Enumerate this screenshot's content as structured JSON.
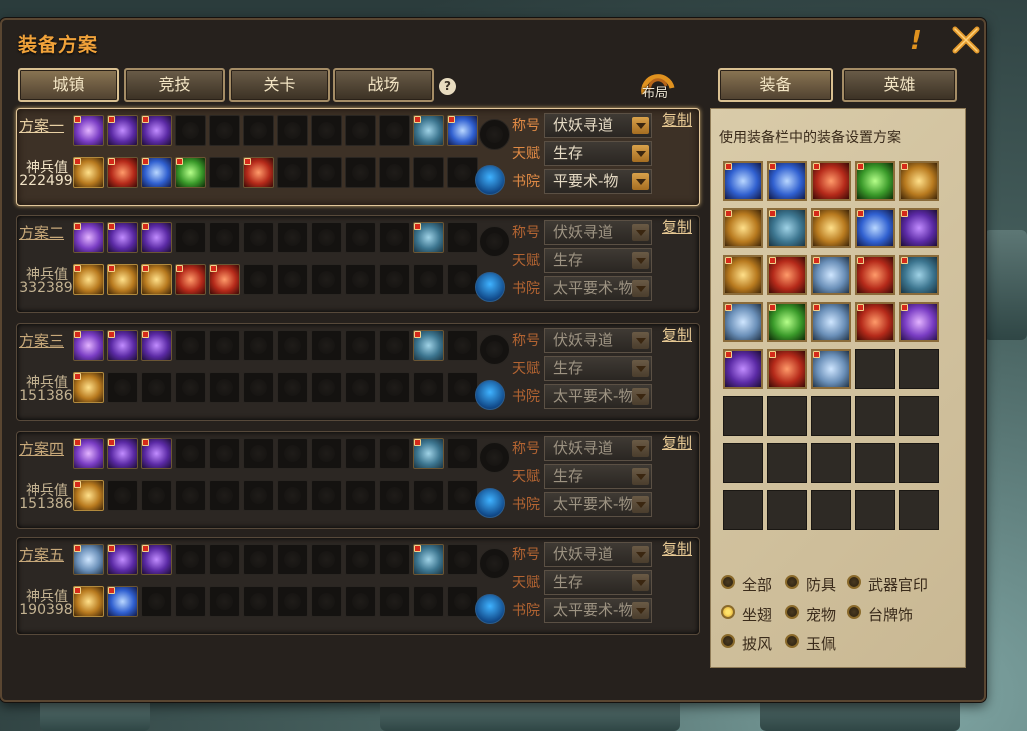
{
  "window": {
    "title": "装备方案"
  },
  "left_tabs": [
    {
      "label": "城镇",
      "active": true
    },
    {
      "label": "竞技",
      "active": false
    },
    {
      "label": "关卡",
      "active": false
    },
    {
      "label": "战场",
      "active": false
    }
  ],
  "layout_button": {
    "label": "布局"
  },
  "right_tabs": [
    {
      "label": "装备",
      "active": true
    },
    {
      "label": "英雄",
      "active": false
    }
  ],
  "field_labels": {
    "title": "称号",
    "talent": "天赋",
    "academy": "书院"
  },
  "power_label": "神兵值",
  "copy_label": "复制",
  "plans": [
    {
      "name": "方案一",
      "power": "222499",
      "title": "伏妖寻道",
      "talent": "生存",
      "academy": "平要术-物",
      "active": true
    },
    {
      "name": "方案二",
      "power": "332389",
      "title": "伏妖寻道",
      "talent": "生存",
      "academy": "太平要术-物",
      "active": false
    },
    {
      "name": "方案三",
      "power": "151386",
      "title": "伏妖寻道",
      "talent": "生存",
      "academy": "太平要术-物",
      "active": false
    },
    {
      "name": "方案四",
      "power": "151386",
      "title": "伏妖寻道",
      "talent": "生存",
      "academy": "太平要术-物",
      "active": false
    },
    {
      "name": "方案五",
      "power": "190398",
      "title": "伏妖寻道",
      "talent": "生存",
      "academy": "太平要术-物",
      "active": false
    }
  ],
  "panel": {
    "description": "使用装备栏中的装备设置方案",
    "filters": [
      {
        "label": "全部",
        "checked": false
      },
      {
        "label": "防具",
        "checked": false
      },
      {
        "label": "武器官印",
        "checked": false
      },
      {
        "label": "坐翅",
        "checked": true
      },
      {
        "label": "宠物",
        "checked": false
      },
      {
        "label": "台牌饰",
        "checked": false
      },
      {
        "label": "披风",
        "checked": false
      },
      {
        "label": "玉佩",
        "checked": false
      }
    ]
  },
  "colors": {
    "accent": "#f0a23a",
    "field_label": "#b36432",
    "panel_bg": "#d7c9a8",
    "badge": "#d52a1a"
  }
}
